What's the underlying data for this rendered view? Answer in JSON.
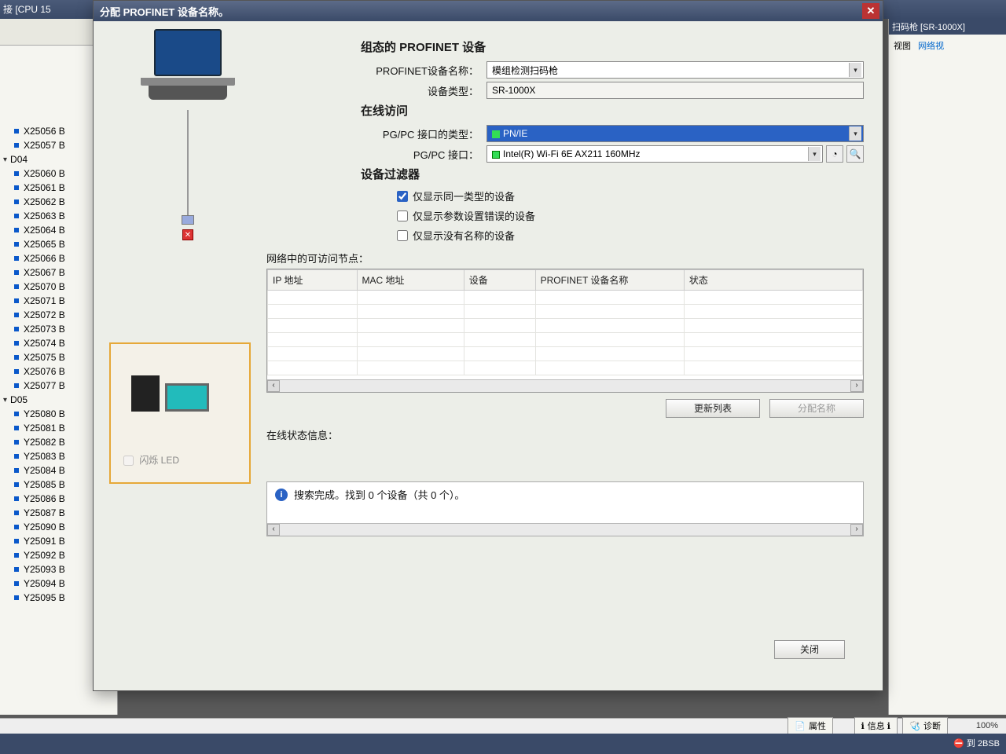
{
  "bg": {
    "top_left": "接 [CPU 15",
    "top_right_device": "扫码枪 [SR-1000X]",
    "right_tabs": [
      "视图",
      "网络视"
    ],
    "tree_parents": [
      "D04",
      "D05"
    ],
    "tree_d04_pre": [
      "X25056 B",
      "X25057 B"
    ],
    "tree_d04": [
      "X25060 B",
      "X25061 B",
      "X25062 B",
      "X25063 B",
      "X25064 B",
      "X25065 B",
      "X25066 B",
      "X25067 B",
      "X25070 B",
      "X25071 B",
      "X25072 B",
      "X25073 B",
      "X25074 B",
      "X25075 B",
      "X25076 B",
      "X25077 B"
    ],
    "tree_d05": [
      "Y25080 B",
      "Y25081 B",
      "Y25082 B",
      "Y25083 B",
      "Y25084 B",
      "Y25085 B",
      "Y25086 B",
      "Y25087 B",
      "Y25090 B",
      "Y25091 B",
      "Y25092 B",
      "Y25093 B",
      "Y25094 B",
      "Y25095 B"
    ],
    "status_tabs": {
      "props": "属性",
      "info": "信息",
      "diag": "诊断"
    },
    "footer_err": "到  2BSB",
    "zoom": "100%"
  },
  "dialog": {
    "title": "分配 PROFINET 设备名称。",
    "sec1": "组态的 PROFINET 设备",
    "lbl_name": "PROFINET设备名称：",
    "val_name": "模组检测扫码枪",
    "lbl_type": "设备类型：",
    "val_type": "SR-1000X",
    "sec2": "在线访问",
    "lbl_iftype": "PG/PC 接口的类型：",
    "val_iftype": "PN/IE",
    "lbl_if": "PG/PC 接口：",
    "val_if": "Intel(R) Wi-Fi 6E AX211 160MHz",
    "sec3": "设备过滤器",
    "chk1": "仅显示同一类型的设备",
    "chk2": "仅显示参数设置错误的设备",
    "chk3": "仅显示没有名称的设备",
    "nodes_label": "网络中的可访问节点：",
    "cols": {
      "ip": "IP 地址",
      "mac": "MAC 地址",
      "dev": "设备",
      "pn": "PROFINET 设备名称",
      "state": "状态"
    },
    "btn_update": "更新列表",
    "btn_assign": "分配名称",
    "led_label": "闪烁 LED",
    "status_label": "在线状态信息：",
    "status_msg": "搜索完成。找到 0 个设备（共 0 个）。",
    "btn_close": "关闭"
  }
}
